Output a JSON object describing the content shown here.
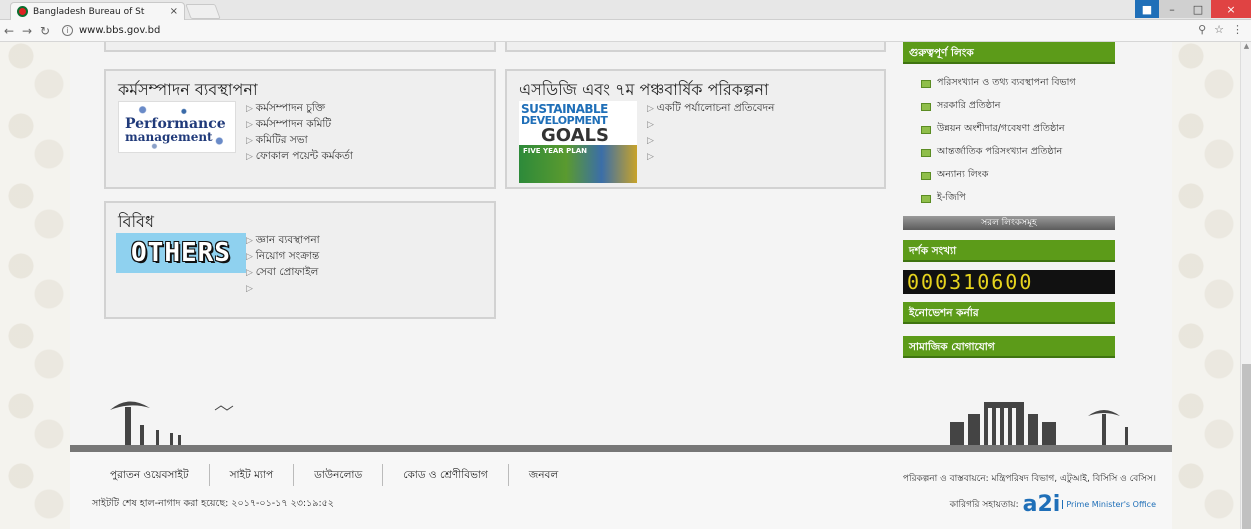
{
  "browser": {
    "tab_title": "Bangladesh Bureau of St",
    "tab_close": "×",
    "url": "www.bbs.gov.bd",
    "window_controls": {
      "minimize": "–",
      "maximize": "□",
      "close": "×"
    }
  },
  "boxes": {
    "performance": {
      "title": "কর্মসম্পাদন ব্যবস্থাপনা",
      "thumb_line1": "Performance",
      "thumb_line2": "management",
      "items": [
        "কর্মসম্পাদন চুক্তি",
        "কর্মসম্পাদন কমিটি",
        "কমিটির সভা",
        "ফোকাল পয়েন্ট কর্মকর্তা"
      ]
    },
    "sdg": {
      "title": "এসডিজি এবং ৭ম পঞ্চবার্ষিক পরিকল্পনা",
      "thumb_line1": "SUSTAINABLE",
      "thumb_line2": "DEVELOPMENT",
      "thumb_line3": "GOALS",
      "thumb_plan": "FIVE YEAR PLAN",
      "items": [
        "একটি পর্যালোচনা প্রতিবেদন",
        "",
        "",
        ""
      ]
    },
    "misc": {
      "title": "বিবিধ",
      "thumb_text": "OTHERS",
      "items": [
        "জ্ঞান ব্যবস্থাপনা",
        "নিয়োগ সংক্রান্ত",
        "সেবা প্রোফাইল",
        ""
      ]
    }
  },
  "sidebar": {
    "important_links_title": "গুরুত্বপূর্ণ লিংক",
    "important_links": [
      "পরিসংখ্যান ও তথ্য ব্যবস্থাপনা বিভাগ",
      "সরকারি প্রতিষ্ঠান",
      "উন্নয়ন অংশীদার/গবেষণা প্রতিষ্ঠান",
      "আন্তর্জাতিক পরিসংখ্যান প্রতিষ্ঠান",
      "অন্যান্য লিংক",
      "ই-জিপি"
    ],
    "simple_links_title": "সরল লিংকসমূহ",
    "visitor_title": "দর্শক সংখ্যা",
    "visitor_count": "000310600",
    "innovation_title": "ইনোভেশন কর্নার",
    "social_title": "সামাজিক যোগাযোগ"
  },
  "footer": {
    "nav": [
      "পুরাতন ওয়েবসাইট",
      "সাইট ম্যাপ",
      "ডাউনলোড",
      "কোড ও শ্রেণীবিভাগ",
      "জনবল"
    ],
    "updated": "সাইটটি শেষ হাল-নাগাদ করা হয়েছে: ২০১৭-০১-১৭ ২৩:১৯:৫২",
    "planning": "পরিকল্পনা ও বাস্তবায়নে: মন্ত্রিপরিষদ বিভাগ, এটুআই, বিসিসি ও বেসিস।",
    "tech_support": "কারিগরি সহায়তায়:",
    "a2i_logo": "a2i",
    "a2i_label": "Prime Minister's Office"
  }
}
